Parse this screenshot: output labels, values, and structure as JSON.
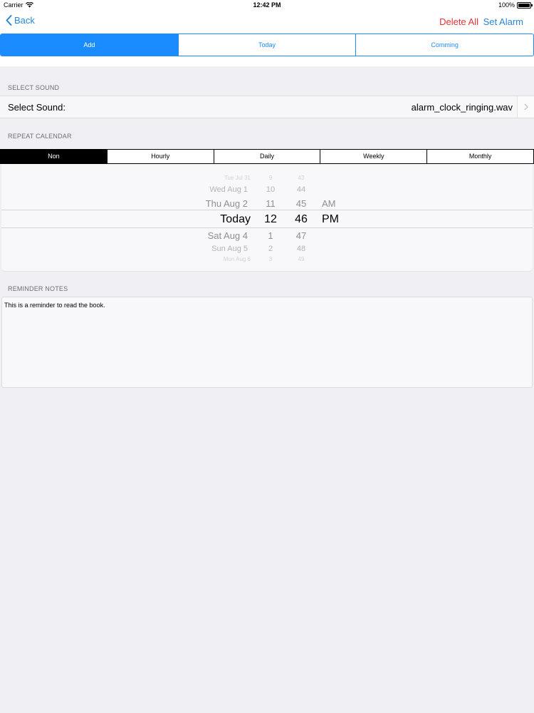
{
  "status_bar": {
    "carrier": "Carrier",
    "time": "12:42 PM",
    "battery": "100%"
  },
  "nav": {
    "back_label": "Back",
    "delete_all_label": "Delete All",
    "set_alarm_label": "Set Alarm"
  },
  "tabs": [
    {
      "label": "Add",
      "active": true
    },
    {
      "label": "Today",
      "active": false
    },
    {
      "label": "Comming",
      "active": false
    }
  ],
  "select_sound": {
    "header": "SELECT SOUND",
    "label": "Select Sound:",
    "value": "alarm_clock_ringing.wav"
  },
  "repeat_calendar": {
    "header": "REPEAT CALENDAR",
    "options": [
      "Non",
      "Hourly",
      "Daily",
      "Weekly",
      "Monthly"
    ],
    "selected": "Non"
  },
  "date_picker": {
    "days": [
      "Tue Jul 31",
      "Wed Aug 1",
      "Thu Aug 2",
      "Today",
      "Sat Aug 4",
      "Sun Aug 5",
      "Mon Aug 6"
    ],
    "hours": [
      "9",
      "10",
      "11",
      "12",
      "1",
      "2",
      "3"
    ],
    "minutes": [
      "43",
      "44",
      "45",
      "46",
      "47",
      "48",
      "49"
    ],
    "ampm": [
      "AM",
      "PM"
    ],
    "selected": {
      "day": "Today",
      "hour": "12",
      "minute": "46",
      "ampm": "PM"
    }
  },
  "reminder_notes": {
    "header": "REMINDER NOTES",
    "text": "This is a reminder to read the book."
  },
  "colors": {
    "accent": "#1a8cff",
    "link": "#2a86d4",
    "destructive": "#e0353a",
    "background": "#efeff4"
  }
}
